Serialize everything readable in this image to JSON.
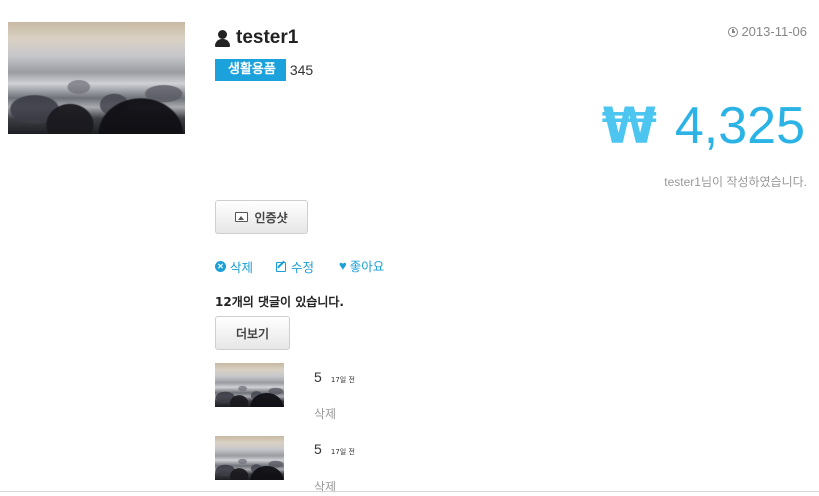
{
  "post": {
    "author": "tester1",
    "category": "생활용품",
    "quantity": "345",
    "date": "2013-11-06",
    "price_symbol": "₩",
    "price": "4,325",
    "written_by": "tester1님이 작성하였습니다."
  },
  "buttons": {
    "proof_shot": "인증샷",
    "more": "더보기"
  },
  "actions": {
    "delete": "삭제",
    "edit": "수정",
    "like": "좋아요"
  },
  "comments": {
    "count_text": "12개의 댓글이 있습니다.",
    "items": [
      {
        "value": "5",
        "time": "17일 전",
        "delete": "삭제"
      },
      {
        "value": "5",
        "time": "17일 전",
        "delete": "삭제"
      }
    ]
  },
  "icons": {
    "author": "user-icon",
    "date": "clock-icon",
    "proof": "picture-icon",
    "delete": "times-circle-icon",
    "edit": "edit-icon",
    "like": "heart-icon"
  },
  "colors": {
    "accent": "#1a9fd6",
    "price": "#2bb3e6",
    "category_bg": "#1ba1db"
  }
}
